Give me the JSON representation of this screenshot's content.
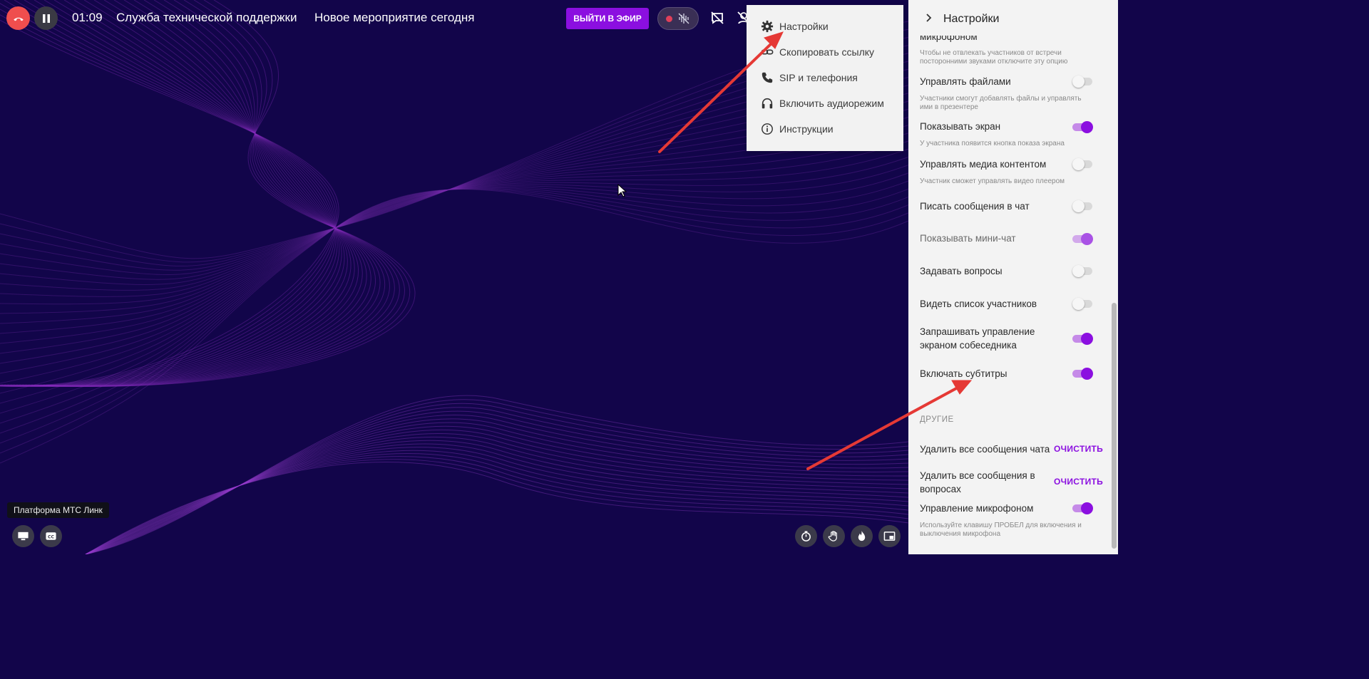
{
  "call": {
    "timer": "01:09",
    "title": "Служба технической поддержки",
    "event": "Новое мероприятие сегодня",
    "live_button": "ВЫЙТИ В ЭФИР"
  },
  "menu": {
    "items": [
      {
        "label": "Настройки",
        "icon": "gear-icon"
      },
      {
        "label": "Скопировать ссылку",
        "icon": "link-icon"
      },
      {
        "label": "SIP и телефония",
        "icon": "phone-icon"
      },
      {
        "label": "Включить аудиорежим",
        "icon": "headphones-icon"
      },
      {
        "label": "Инструкции",
        "icon": "info-icon"
      }
    ]
  },
  "panel": {
    "title": "Настройки",
    "cut_label": "микрофоном",
    "cut_hint": "Чтобы не отвлекать участников от встречи посторонними звуками отключите эту опцию",
    "rows": [
      {
        "label": "Управлять файлами",
        "hint": "Участники смогут добавлять файлы и управлять ими в презентере",
        "on": false
      },
      {
        "label": "Показывать экран",
        "hint": "У участника появится кнопка показа экрана",
        "on": true
      },
      {
        "label": "Управлять медиа контентом",
        "hint": "Участник сможет управлять видео плеером",
        "on": false
      },
      {
        "label": "Писать сообщения в чат",
        "hint": "",
        "on": false
      },
      {
        "label": "Показывать мини-чат",
        "hint": "",
        "on": true
      },
      {
        "label": "Задавать вопросы",
        "hint": "",
        "on": false
      },
      {
        "label": "Видеть список участников",
        "hint": "",
        "on": false
      },
      {
        "label": "Запрашивать управление экраном собеседника",
        "hint": "",
        "on": true
      },
      {
        "label": "Включать субтитры",
        "hint": "",
        "on": true
      }
    ],
    "other_section": "ДРУГИЕ",
    "other": [
      {
        "label": "Удалить все сообщения чата",
        "action": "ОЧИСТИТЬ"
      },
      {
        "label": "Удалить все сообщения в вопросах",
        "action": "ОЧИСТИТЬ"
      }
    ],
    "mic": {
      "label": "Управление микрофоном",
      "hint": "Используйте клавишу ПРОБЕЛ для включения и выключения микрофона",
      "on": true
    }
  },
  "bottom": {
    "platform_tag": "Платформа МТС Линк"
  },
  "colors": {
    "background": "#12054a",
    "accent": "#8b0fe0",
    "end_call": "#ef4e4e",
    "annotation_arrow": "#e53935"
  }
}
